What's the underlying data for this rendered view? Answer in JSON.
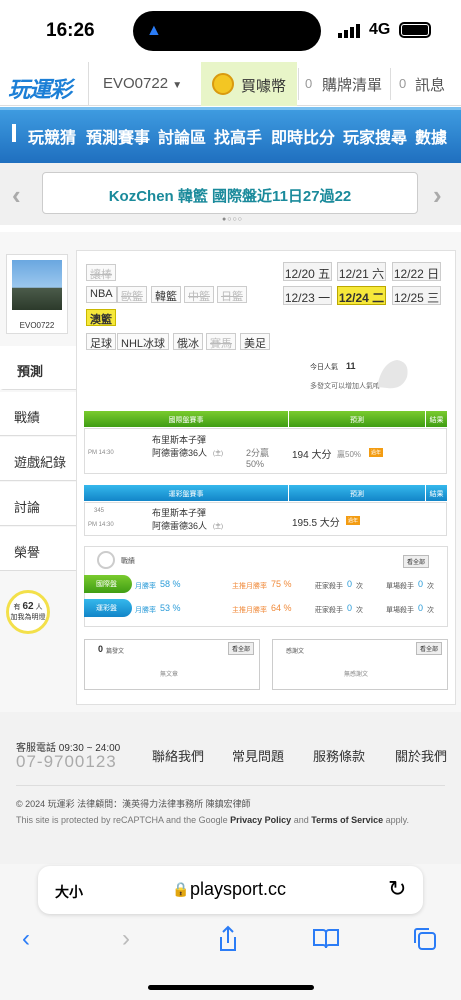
{
  "status": {
    "time": "16:26",
    "network": "4G"
  },
  "topnav": {
    "user": "EVO0722",
    "buy_coin": "買噱幣",
    "brand_count": "0",
    "brand_label": "購牌清單",
    "msg_count": "0",
    "msg_label": "訊息"
  },
  "menu": [
    "玩競猜",
    "預測賽事",
    "討論區",
    "找高手",
    "即時比分",
    "玩家搜尋",
    "數據"
  ],
  "banner": {
    "text": "KozChen 韓籃 國際盤近11日27過22"
  },
  "profile": {
    "username": "EVO0722"
  },
  "sidetabs": [
    "預測",
    "戰績",
    "遊戲紀錄",
    "討論",
    "榮譽"
  ],
  "followers": {
    "prefix": "有",
    "count": "62",
    "suffix": "人",
    "line2": "加我為明燈"
  },
  "chips": [
    "讓棒",
    "NBA",
    "歐籃",
    "韓籃",
    "中籃",
    "日籃",
    "澳籃",
    "足球",
    "NHL冰球",
    "俄冰",
    "賽馬",
    "美足"
  ],
  "dates": [
    "12/20 五",
    "12/21 六",
    "12/22 日",
    "12/23 一",
    "12/24 二",
    "12/25 三"
  ],
  "popular": {
    "label": "今日人氣",
    "value": "11",
    "hint": "多發文可以增加人氣唷～"
  },
  "intl_table": {
    "h1": "國際盤賽事",
    "h2": "預測",
    "h3": "結果",
    "time": "PM 14:30",
    "team1": "布里斯本子彈",
    "team2": "阿德雷德36人",
    "home": "(主)",
    "spread": "2分贏",
    "spread2": "50%",
    "pred": "194 大分",
    "pred_sub": "贏50%",
    "tag": "過年"
  },
  "lottery_table": {
    "h1": "運彩盤賽事",
    "h2": "預測",
    "h3": "結果",
    "num": "345",
    "time": "PM 14:30",
    "team1": "布里斯本子彈",
    "team2": "阿德雷德36人",
    "home": "(主)",
    "pred": "195.5 大分",
    "tag": "過年"
  },
  "stats": {
    "title": "戰績",
    "see_all": "看全部",
    "rows": [
      {
        "label": "國際盤",
        "month": "月勝率",
        "month_v": "58 %",
        "main": "主推月勝率",
        "main_v": "75 %",
        "zk": "莊家殺手",
        "zk_v": "0",
        "zk_u": "次",
        "dc": "單場殺手",
        "dc_v": "0",
        "dc_u": "次"
      },
      {
        "label": "運彩盤",
        "month": "月勝率",
        "month_v": "53 %",
        "main": "主推月勝率",
        "main_v": "64 %",
        "zk": "莊家殺手",
        "zk_v": "0",
        "zk_u": "次",
        "dc": "單場殺手",
        "dc_v": "0",
        "dc_u": "次"
      }
    ]
  },
  "posts": {
    "count": "0",
    "label": "篇發文",
    "see_all": "看全部",
    "empty": "無文章"
  },
  "thanks": {
    "label": "感謝文",
    "see_all": "看全部",
    "empty": "無感謝文"
  },
  "footer": {
    "phone_label": "客服電話 09:30 ~ 24:00",
    "phone": "07-9700123",
    "links": [
      "聯絡我們",
      "常見問題",
      "服務條款",
      "關於我們"
    ],
    "copyright": "© 2024 玩運彩 法律顧問：漢英得力法律事務所 陳鎮宏律師",
    "captcha_a": "This site is protected by reCAPTCHA and the Google",
    "privacy": "Privacy Policy",
    "and": "and",
    "terms": "Terms of Service",
    "apply": "apply."
  },
  "browser": {
    "textsize": "大小",
    "url": "playsport.cc"
  },
  "colors": {
    "accent_blue": "#1f6fbf",
    "accent_green": "#3f9d14",
    "highlight": "#f6e83a"
  }
}
